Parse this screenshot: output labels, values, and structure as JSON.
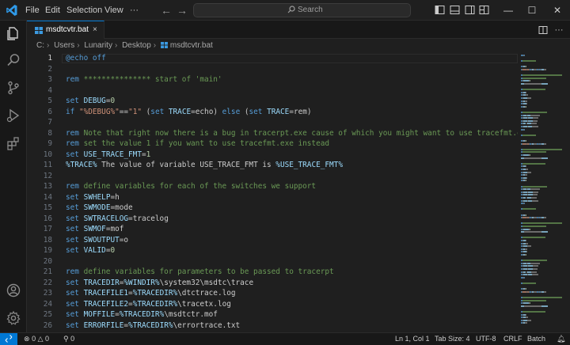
{
  "menu": [
    "File",
    "Edit",
    "Selection",
    "View"
  ],
  "search": {
    "placeholder": "Search"
  },
  "window_controls": {
    "minimize": "—",
    "maximize": "☐",
    "close": "✕"
  },
  "tab": {
    "label": "msdtcvtr.bat",
    "close": "×"
  },
  "breadcrumb": [
    "C:",
    "Users",
    "Lunarity",
    "Desktop",
    "msdtcvtr.bat"
  ],
  "code_lines": [
    {
      "n": "1",
      "tokens": [
        [
          "k",
          "@echo"
        ],
        [
          "d",
          " "
        ],
        [
          "k",
          "off"
        ]
      ]
    },
    {
      "n": "2",
      "tokens": []
    },
    {
      "n": "3",
      "tokens": [
        [
          "k",
          "rem"
        ],
        [
          "c",
          " *************** start of 'main'"
        ]
      ]
    },
    {
      "n": "4",
      "tokens": []
    },
    {
      "n": "5",
      "tokens": [
        [
          "k",
          "set"
        ],
        [
          "d",
          " "
        ],
        [
          "v",
          "DEBUG"
        ],
        [
          "d",
          "="
        ],
        [
          "n",
          "0"
        ]
      ]
    },
    {
      "n": "6",
      "tokens": [
        [
          "k",
          "if"
        ],
        [
          "d",
          " "
        ],
        [
          "s",
          "\"%DEBUG%\""
        ],
        [
          "d",
          "=="
        ],
        [
          "s",
          "\"1\""
        ],
        [
          "d",
          " ("
        ],
        [
          "k",
          "set"
        ],
        [
          "d",
          " "
        ],
        [
          "v",
          "TRACE"
        ],
        [
          "d",
          "=echo) "
        ],
        [
          "k",
          "else"
        ],
        [
          "d",
          " ("
        ],
        [
          "k",
          "set"
        ],
        [
          "d",
          " "
        ],
        [
          "v",
          "TRACE"
        ],
        [
          "d",
          "=rem)"
        ]
      ]
    },
    {
      "n": "7",
      "tokens": []
    },
    {
      "n": "8",
      "tokens": [
        [
          "k",
          "rem"
        ],
        [
          "c",
          " Note that right now there is a bug in tracerpt.exe cause of which you might want to use tracefmt.exe"
        ]
      ]
    },
    {
      "n": "9",
      "tokens": [
        [
          "k",
          "rem"
        ],
        [
          "c",
          " set the value 1 if you want to use tracefmt.exe instead"
        ]
      ]
    },
    {
      "n": "10",
      "tokens": [
        [
          "k",
          "set"
        ],
        [
          "d",
          " "
        ],
        [
          "v",
          "USE_TRACE_FMT"
        ],
        [
          "d",
          "="
        ],
        [
          "n",
          "1"
        ]
      ]
    },
    {
      "n": "11",
      "tokens": [
        [
          "v",
          "%TRACE%"
        ],
        [
          "d",
          " The value of variable USE_TRACE_FMT is "
        ],
        [
          "v",
          "%USE_TRACE_FMT%"
        ]
      ]
    },
    {
      "n": "12",
      "tokens": []
    },
    {
      "n": "13",
      "tokens": [
        [
          "k",
          "rem"
        ],
        [
          "c",
          " define variables for each of the switches we support"
        ]
      ]
    },
    {
      "n": "14",
      "tokens": [
        [
          "k",
          "set"
        ],
        [
          "d",
          " "
        ],
        [
          "v",
          "SWHELP"
        ],
        [
          "d",
          "=h"
        ]
      ]
    },
    {
      "n": "15",
      "tokens": [
        [
          "k",
          "set"
        ],
        [
          "d",
          " "
        ],
        [
          "v",
          "SWMODE"
        ],
        [
          "d",
          "=mode"
        ]
      ]
    },
    {
      "n": "16",
      "tokens": [
        [
          "k",
          "set"
        ],
        [
          "d",
          " "
        ],
        [
          "v",
          "SWTRACELOG"
        ],
        [
          "d",
          "=tracelog"
        ]
      ]
    },
    {
      "n": "17",
      "tokens": [
        [
          "k",
          "set"
        ],
        [
          "d",
          " "
        ],
        [
          "v",
          "SWMOF"
        ],
        [
          "d",
          "=mof"
        ]
      ]
    },
    {
      "n": "18",
      "tokens": [
        [
          "k",
          "set"
        ],
        [
          "d",
          " "
        ],
        [
          "v",
          "SWOUTPUT"
        ],
        [
          "d",
          "=o"
        ]
      ]
    },
    {
      "n": "19",
      "tokens": [
        [
          "k",
          "set"
        ],
        [
          "d",
          " "
        ],
        [
          "v",
          "VALID"
        ],
        [
          "d",
          "="
        ],
        [
          "n",
          "0"
        ]
      ]
    },
    {
      "n": "20",
      "tokens": []
    },
    {
      "n": "21",
      "tokens": [
        [
          "k",
          "rem"
        ],
        [
          "c",
          " define variables for parameters to be passed to tracerpt"
        ]
      ]
    },
    {
      "n": "22",
      "tokens": [
        [
          "k",
          "set"
        ],
        [
          "d",
          " "
        ],
        [
          "v",
          "TRACEDIR"
        ],
        [
          "d",
          "="
        ],
        [
          "v",
          "%WINDIR%"
        ],
        [
          "d",
          "\\system32\\msdtc\\trace"
        ]
      ]
    },
    {
      "n": "23",
      "tokens": [
        [
          "k",
          "set"
        ],
        [
          "d",
          " "
        ],
        [
          "v",
          "TRACEFILE1"
        ],
        [
          "d",
          "="
        ],
        [
          "v",
          "%TRACEDIR%"
        ],
        [
          "d",
          "\\dtctrace.log"
        ]
      ]
    },
    {
      "n": "24",
      "tokens": [
        [
          "k",
          "set"
        ],
        [
          "d",
          " "
        ],
        [
          "v",
          "TRACEFILE2"
        ],
        [
          "d",
          "="
        ],
        [
          "v",
          "%TRACEDIR%"
        ],
        [
          "d",
          "\\tracetx.log"
        ]
      ]
    },
    {
      "n": "25",
      "tokens": [
        [
          "k",
          "set"
        ],
        [
          "d",
          " "
        ],
        [
          "v",
          "MOFFILE"
        ],
        [
          "d",
          "="
        ],
        [
          "v",
          "%TRACEDIR%"
        ],
        [
          "d",
          "\\msdtctr.mof"
        ]
      ]
    },
    {
      "n": "26",
      "tokens": [
        [
          "k",
          "set"
        ],
        [
          "d",
          " "
        ],
        [
          "v",
          "ERRORFILE"
        ],
        [
          "d",
          "="
        ],
        [
          "v",
          "%TRACEDIR%"
        ],
        [
          "d",
          "\\errortrace.txt"
        ]
      ]
    }
  ],
  "status": {
    "errors": "0",
    "warnings": "0",
    "ports": "0",
    "position": "Ln 1, Col 1",
    "tab_size": "Tab Size: 4",
    "encoding": "UTF-8",
    "eol": "CRLF",
    "language": "Batch"
  },
  "colors": {
    "accent": "#0078d4",
    "keyword": "#569cd6",
    "comment": "#6a9955",
    "string": "#ce9178",
    "variable": "#9cdcfe",
    "number": "#b5cea8"
  }
}
